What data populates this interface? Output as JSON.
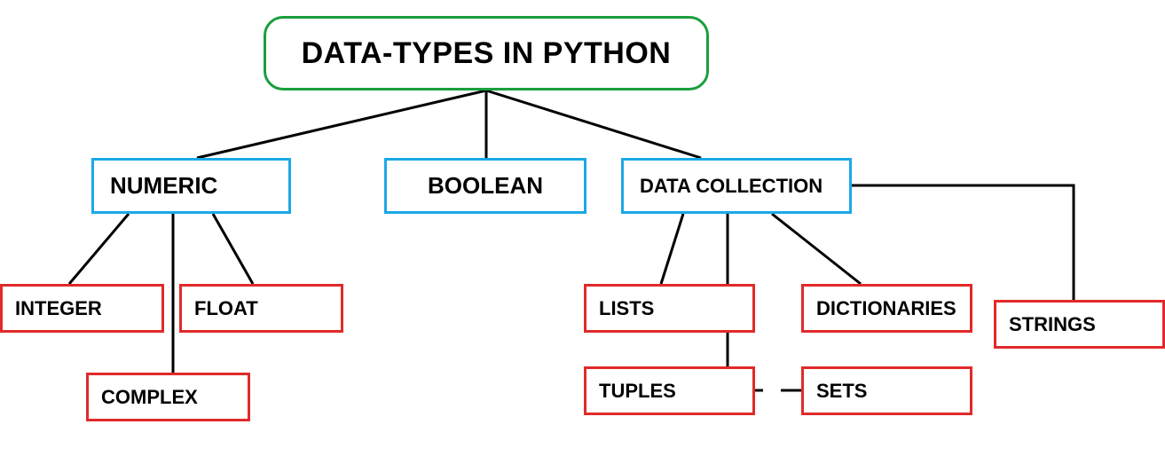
{
  "root": {
    "label": "DATA-TYPES IN PYTHON"
  },
  "level1": {
    "numeric": "NUMERIC",
    "boolean": "BOOLEAN",
    "collection": "DATA COLLECTION"
  },
  "numeric_children": {
    "integer": "INTEGER",
    "float": "FLOAT",
    "complex": "COMPLEX"
  },
  "collection_children": {
    "lists": "LISTS",
    "dictionaries": "DICTIONARIES",
    "tuples": "TUPLES",
    "sets": "SETS",
    "strings": "STRINGS"
  }
}
